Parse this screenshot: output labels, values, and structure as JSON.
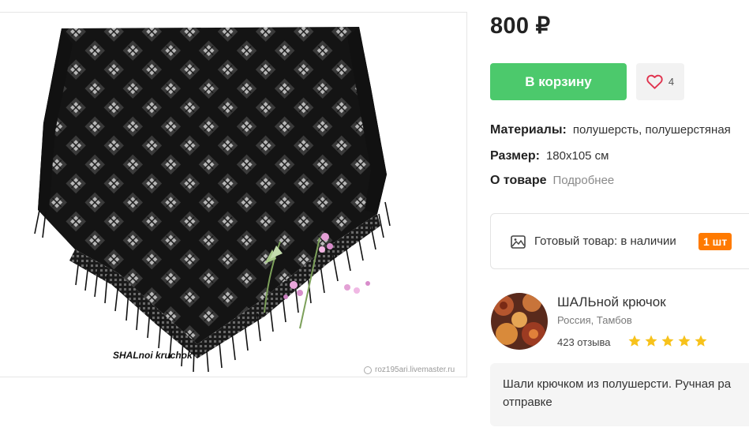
{
  "product": {
    "photo_caption": "SHALnoi kruchok",
    "photo_site": "roz195ari.livemaster.ru",
    "price": "800 ₽",
    "cart_label": "В корзину",
    "favorites_count": "4",
    "materials_label": "Материалы:",
    "materials_value": "полушерсть, полушерстяная",
    "size_label": "Размер:",
    "size_value": "180x105 см",
    "about_label": "О товаре",
    "about_link": "Подробнее",
    "stock_text": "Готовый товар: в наличии",
    "stock_qty": "1 шт"
  },
  "shop": {
    "name": "ШАЛЬной крючок",
    "location": "Россия, Тамбов",
    "reviews": "423 отзыва",
    "rating": 5,
    "avatar_caption": "ШАЛЬной крючок",
    "description": "Шали крючком из полушерсти. Ручная ра отправке"
  },
  "colors": {
    "cart_green": "#4cc96c",
    "badge_orange": "#ff7a00",
    "star_yellow": "#f7c21b",
    "heart_red": "#e0344f"
  },
  "icons": {
    "favorite": "heart-icon",
    "stock": "image-icon",
    "rating": "star-icon"
  }
}
